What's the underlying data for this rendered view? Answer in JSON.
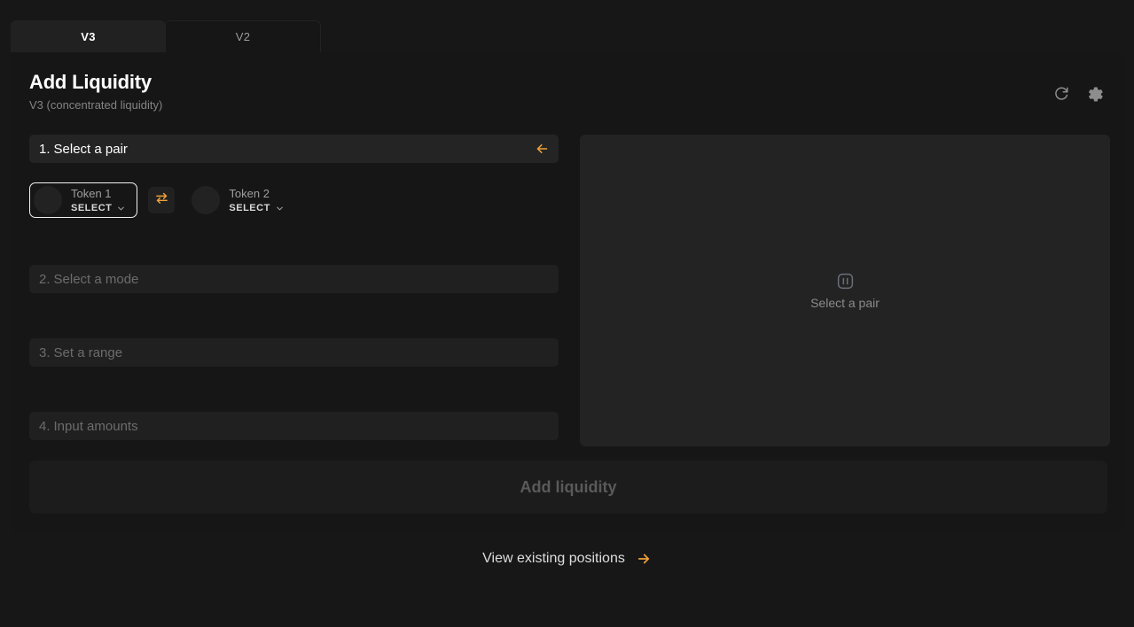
{
  "tabs": [
    {
      "label": "V3",
      "active": true
    },
    {
      "label": "V2",
      "active": false
    }
  ],
  "header": {
    "title": "Add Liquidity",
    "subtitle": "V3 (concentrated liquidity)",
    "refresh_icon": "refresh-icon",
    "settings_icon": "gear-icon"
  },
  "steps": [
    {
      "number": "1.",
      "label": "Select a pair",
      "state": "active"
    },
    {
      "number": "2.",
      "label": "Select a mode",
      "state": "idle"
    },
    {
      "number": "3.",
      "label": "Set a range",
      "state": "idle"
    },
    {
      "number": "4.",
      "label": "Input amounts",
      "state": "idle"
    }
  ],
  "pair": {
    "token1": {
      "name": "Token 1",
      "action": "SELECT",
      "focused": true
    },
    "token2": {
      "name": "Token 2",
      "action": "SELECT",
      "focused": false
    },
    "swap_icon": "swap-arrows-icon"
  },
  "chart_panel": {
    "icon": "chart-placeholder-icon",
    "empty_text": "Select a pair"
  },
  "cta": {
    "label": "Add liquidity",
    "disabled": true
  },
  "footer": {
    "label": "View existing positions",
    "arrow_icon": "arrow-right-icon"
  },
  "colors": {
    "accent": "#f0a23a",
    "page_bg": "#171717",
    "card_bg": "#161616",
    "panel_bg": "#232323",
    "step_active_bg": "#242424",
    "step_idle_bg": "#202020"
  }
}
